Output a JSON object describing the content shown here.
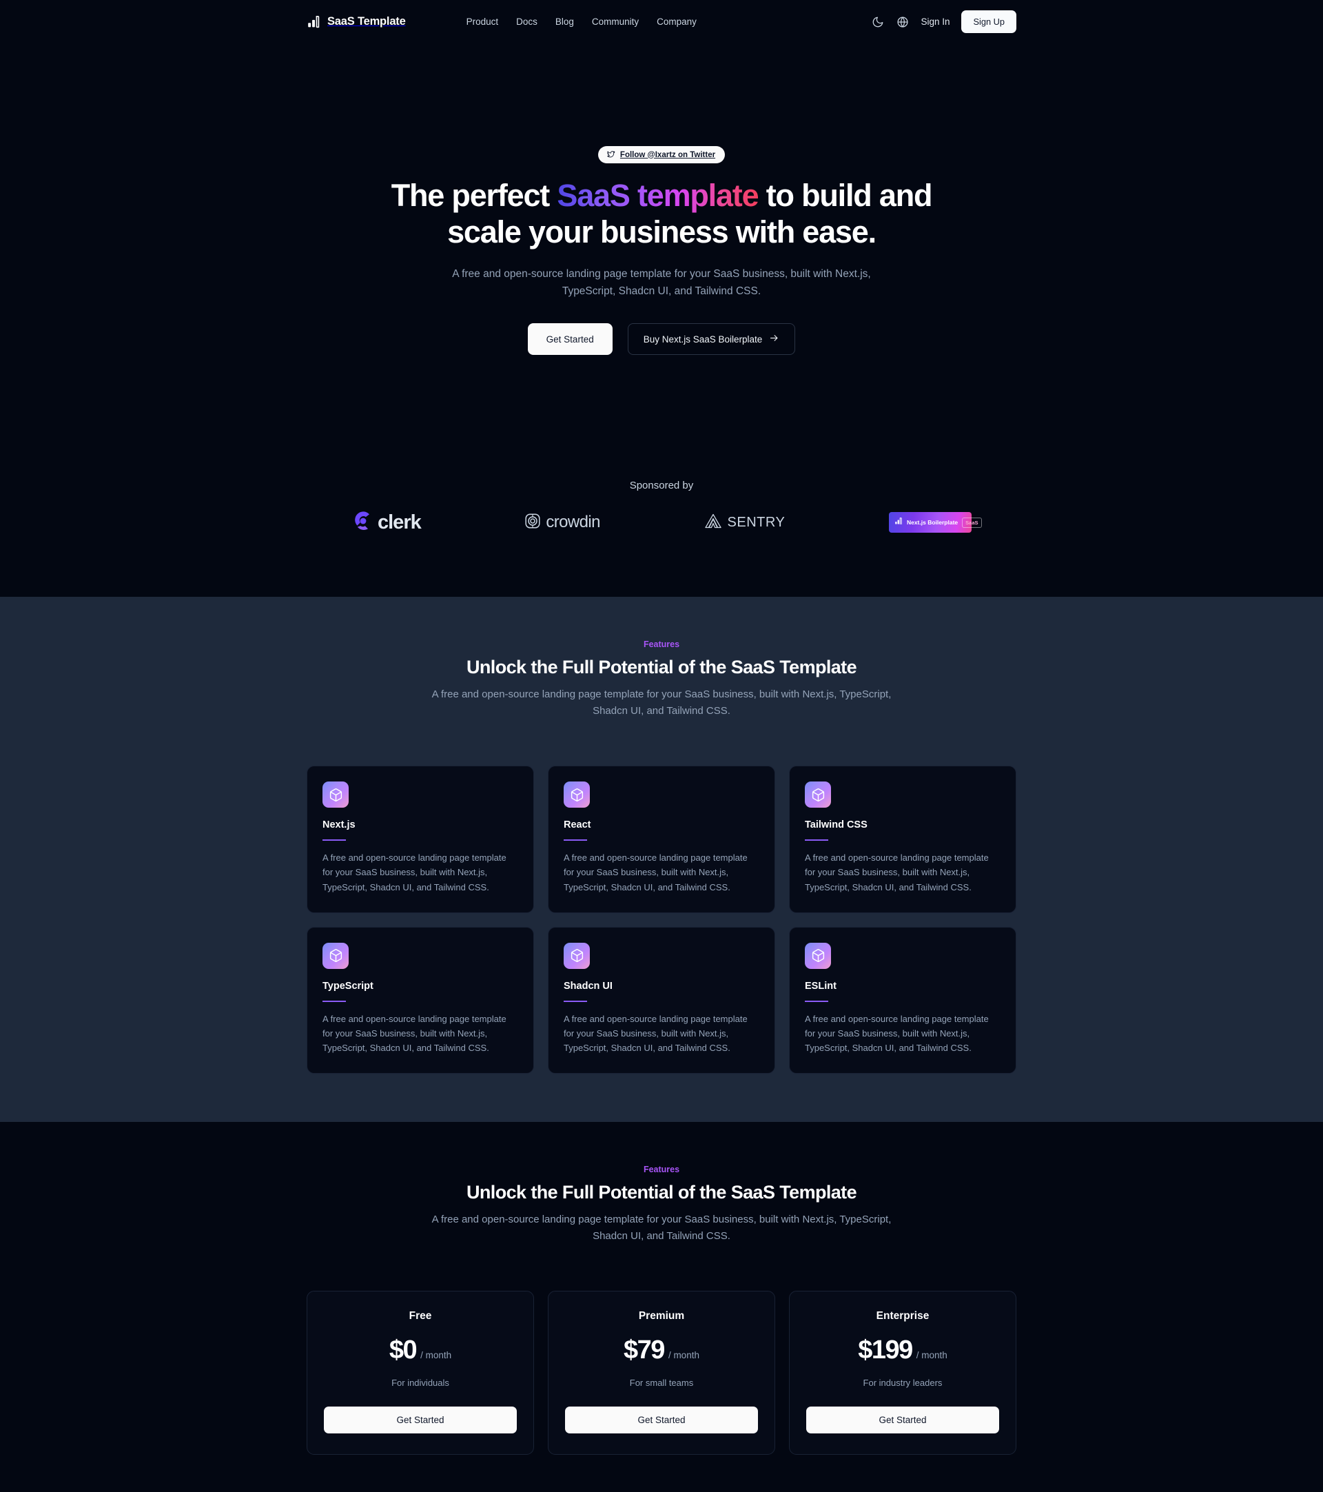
{
  "header": {
    "logo_text": "SaaS Template",
    "nav": [
      {
        "label": "Product"
      },
      {
        "label": "Docs"
      },
      {
        "label": "Blog"
      },
      {
        "label": "Community"
      },
      {
        "label": "Company"
      }
    ],
    "signin_label": "Sign In",
    "signup_label": "Sign Up"
  },
  "hero": {
    "badge": "Follow @Ixartz on Twitter",
    "title_part1": "The perfect ",
    "title_gradient": "SaaS template",
    "title_part2": " to build and scale your business with ease.",
    "subtitle": "A free and open-source landing page template for your SaaS business, built with Next.js, TypeScript, Shadcn UI, and Tailwind CSS.",
    "primary_button": "Get Started",
    "secondary_button": "Buy Next.js SaaS Boilerplate"
  },
  "sponsors": {
    "label": "Sponsored by",
    "items": [
      {
        "name": "clerk",
        "text": "clerk"
      },
      {
        "name": "crowdin",
        "text": "crowdin"
      },
      {
        "name": "sentry",
        "text": "SENTRY"
      },
      {
        "name": "nextjs-boilerplate",
        "text": "Next.js Boilerplate",
        "pill": "SaaS"
      }
    ]
  },
  "features": {
    "eyebrow": "Features",
    "title": "Unlock the Full Potential of the SaaS Template",
    "subtitle": "A free and open-source landing page template for your SaaS business, built with Next.js, TypeScript, Shadcn UI, and Tailwind CSS.",
    "card_desc": "A free and open-source landing page template for your SaaS business, built with Next.js, TypeScript, Shadcn UI, and Tailwind CSS.",
    "cards": [
      {
        "title": "Next.js",
        "desc": "A free and open-source landing page template for your SaaS business, built with Next.js, TypeScript, Shadcn UI, and Tailwind CSS."
      },
      {
        "title": "React",
        "desc": "A free and open-source landing page template for your SaaS business, built with Next.js, TypeScript, Shadcn UI, and Tailwind CSS."
      },
      {
        "title": "Tailwind CSS",
        "desc": "A free and open-source landing page template for your SaaS business, built with Next.js, TypeScript, Shadcn UI, and Tailwind CSS."
      },
      {
        "title": "TypeScript",
        "desc": "A free and open-source landing page template for your SaaS business, built with Next.js, TypeScript, Shadcn UI, and Tailwind CSS."
      },
      {
        "title": "Shadcn UI",
        "desc": "A free and open-source landing page template for your SaaS business, built with Next.js, TypeScript, Shadcn UI, and Tailwind CSS."
      },
      {
        "title": "ESLint",
        "desc": "A free and open-source landing page template for your SaaS business, built with Next.js, TypeScript, Shadcn UI, and Tailwind CSS."
      }
    ]
  },
  "pricing": {
    "eyebrow": "Features",
    "title": "Unlock the Full Potential of the SaaS Template",
    "subtitle": "A free and open-source landing page template for your SaaS business, built with Next.js, TypeScript, Shadcn UI, and Tailwind CSS.",
    "plans": [
      {
        "name": "Free",
        "amount": "$0",
        "period": "/ month",
        "desc": "For individuals",
        "button": "Get Started"
      },
      {
        "name": "Premium",
        "amount": "$79",
        "period": "/ month",
        "desc": "For small teams",
        "button": "Get Started"
      },
      {
        "name": "Enterprise",
        "amount": "$199",
        "period": "/ month",
        "desc": "For industry leaders",
        "button": "Get Started"
      }
    ]
  },
  "colors": {
    "hero_bg": "#030712",
    "features_bg": "#1e293b",
    "card_bg": "#060b18",
    "accent_purple": "#a855f7",
    "gradient_start": "#4f46e5",
    "gradient_end": "#ec4899",
    "button_light": "#fafafa"
  }
}
